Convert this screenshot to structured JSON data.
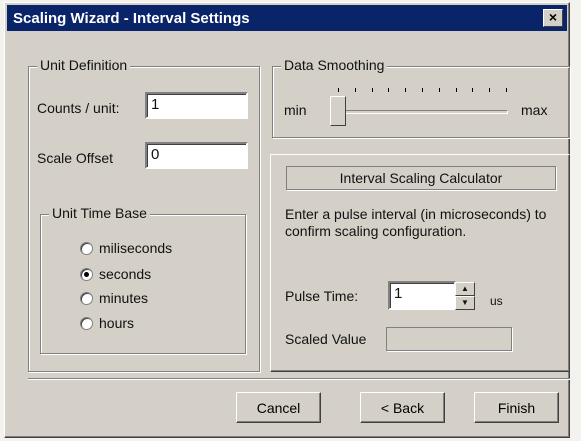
{
  "window": {
    "title": "Scaling Wizard - Interval Settings",
    "close_symbol": "×"
  },
  "unit_definition": {
    "legend": "Unit Definition",
    "counts_label": "Counts / unit:",
    "counts_value": "1",
    "offset_label": "Scale Offset",
    "offset_value": "0"
  },
  "time_base": {
    "legend": "Unit Time Base",
    "options": [
      {
        "label": "miliseconds",
        "checked": false
      },
      {
        "label": "seconds",
        "checked": true
      },
      {
        "label": "minutes",
        "checked": false
      },
      {
        "label": "hours",
        "checked": false
      }
    ]
  },
  "smoothing": {
    "legend": "Data Smoothing",
    "min_label": "min",
    "max_label": "max",
    "level": 0
  },
  "calculator": {
    "header": "Interval Scaling Calculator",
    "description": "Enter a pulse interval (in microseconds) to confirm scaling configuration.",
    "pulse_label": "Pulse Time:",
    "pulse_value": "1",
    "pulse_unit": "us",
    "scaled_label": "Scaled Value"
  },
  "buttons": {
    "cancel": "Cancel",
    "back": "< Back",
    "finish": "Finish"
  }
}
